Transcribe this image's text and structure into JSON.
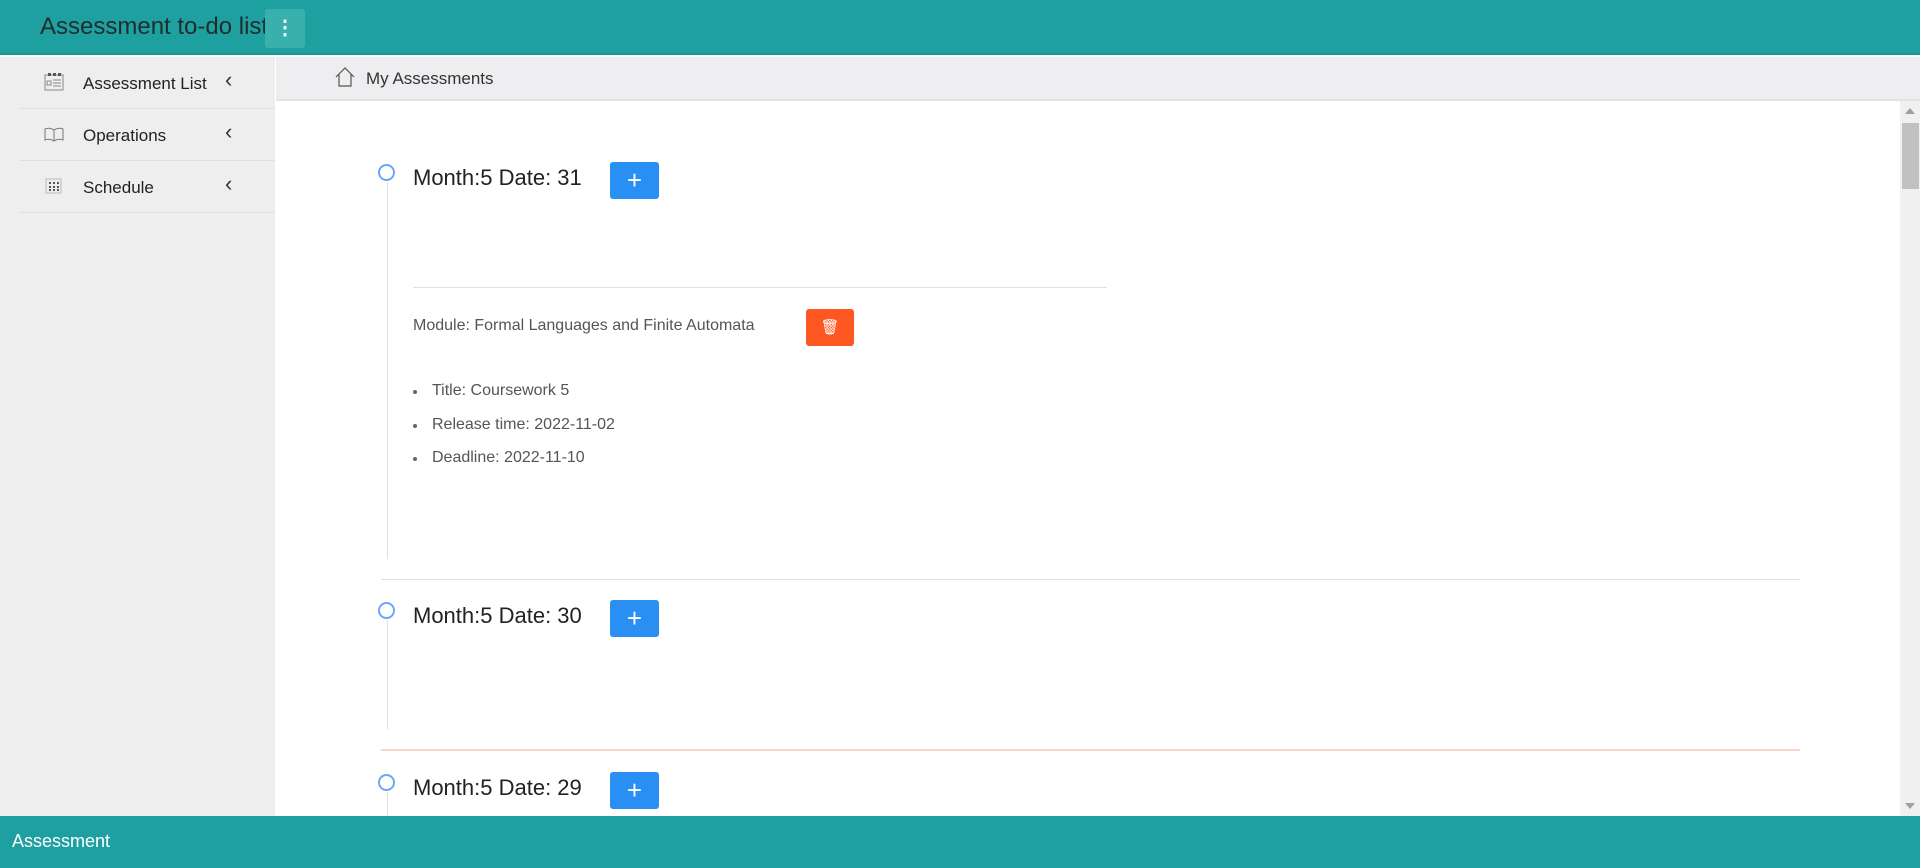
{
  "header": {
    "title": "Assessment to-do list",
    "menu_icon": "vertical-dots-icon"
  },
  "sidebar": {
    "items": [
      {
        "label": "Assessment List",
        "icon": "calendar-list-icon"
      },
      {
        "label": "Operations",
        "icon": "book-icon"
      },
      {
        "label": "Schedule",
        "icon": "grid-calendar-icon"
      }
    ]
  },
  "breadcrumb": {
    "label": "My Assessments",
    "icon": "home-icon"
  },
  "timeline": [
    {
      "title": "Month:5 Date: 31",
      "add_label": "+",
      "assessments": [
        {
          "module": "Module: Formal Languages and Finite Automata",
          "details": [
            "Title: Coursework 5",
            "Release time: 2022-11-02",
            "Deadline: 2022-11-10"
          ]
        }
      ]
    },
    {
      "title": "Month:5 Date: 30",
      "add_label": "+"
    },
    {
      "title": "Month:5 Date: 29",
      "add_label": "+"
    }
  ],
  "footer": {
    "text": "Assessment"
  },
  "colors": {
    "brand": "#1ea0a0",
    "add_button": "#2a8ff2",
    "delete_button": "#ff5722"
  }
}
